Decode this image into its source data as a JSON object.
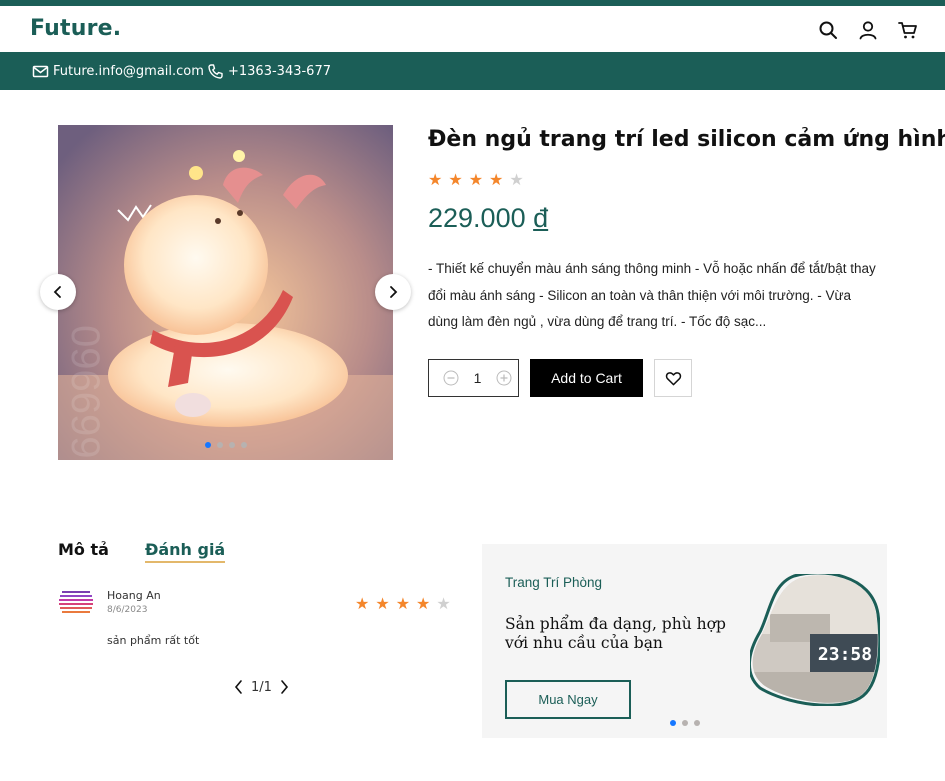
{
  "header": {
    "logo": "Future.",
    "icons": [
      "search-icon",
      "user-icon",
      "cart-icon"
    ]
  },
  "infobar": {
    "email": "Future.info@gmail.com",
    "phone": "+1363-343-677"
  },
  "product": {
    "title": "Đèn ngủ trang trí led silicon cảm ứng hình",
    "rating": 4,
    "rating_max": 5,
    "price_value": "229.000",
    "price_currency": "đ",
    "description": "- Thiết kế chuyển màu ánh sáng thông minh - Vỗ hoặc nhấn để tắt/bật thay đổi màu ánh sáng - Silicon an toàn và thân thiện với môi trường. - Vừa dùng làm đèn ngủ , vừa dùng để trang trí. - Tốc độ sạc...",
    "quantity": "1",
    "add_to_cart": "Add to Cart",
    "gallery": {
      "slide_count": 4,
      "active_slide": 1
    }
  },
  "tabs": [
    {
      "label": "Mô tả"
    },
    {
      "label": "Đánh giá"
    }
  ],
  "review": {
    "name": "Hoang An",
    "date": "8/6/2023",
    "text": "sản phẩm rất tốt",
    "rating": 4,
    "rating_max": 5
  },
  "pager": {
    "text": "1/1"
  },
  "promo": {
    "kicker": "Trang Trí Phòng",
    "headline": "Sản phẩm đa dạng, phù hợp với nhu cầu của bạn",
    "button": "Mua Ngay",
    "slide_count": 3,
    "active_slide": 1,
    "clock_text": "23:58"
  },
  "colors": {
    "brand": "#1b5e57",
    "star_on": "#f4862b",
    "star_off": "#d0d0d0",
    "tab_underline": "#e3b86b"
  }
}
